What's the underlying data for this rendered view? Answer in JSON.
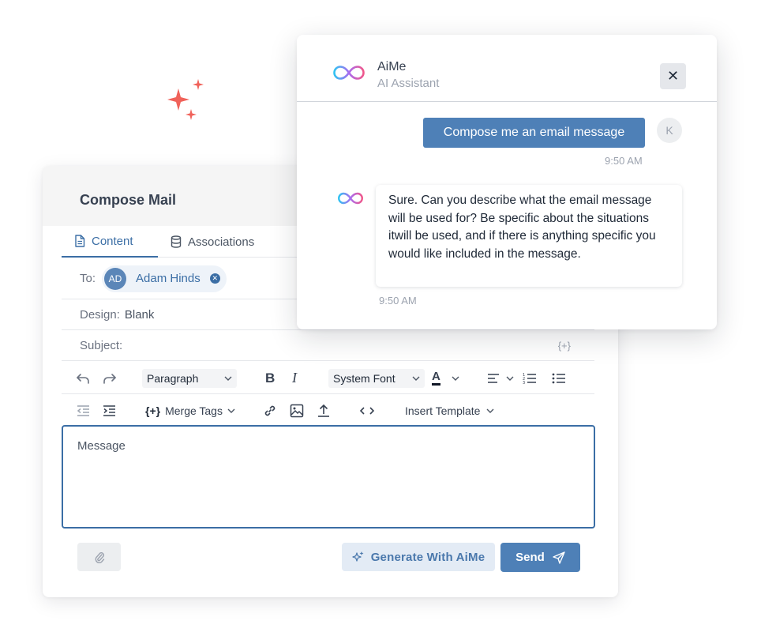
{
  "compose": {
    "title": "Compose Mail",
    "tabs": [
      {
        "label": "Content",
        "icon": "document-icon",
        "active": true
      },
      {
        "label": "Associations",
        "icon": "database-icon",
        "active": false
      }
    ],
    "to_label": "To:",
    "recipient": {
      "initials": "AD",
      "name": "Adam Hinds"
    },
    "design_label": "Design:",
    "design_value": "Blank",
    "subject_label": "Subject:",
    "subject_merge": "{+}",
    "toolbar": {
      "paragraph": "Paragraph",
      "bold": "B",
      "italic": "I",
      "font": "System Font",
      "text_color": "A",
      "merge_tags": "Merge Tags",
      "merge_icon": "{+}",
      "insert_template": "Insert Template"
    },
    "message_placeholder": "Message",
    "generate_label": "Generate With AiMe",
    "send_label": "Send"
  },
  "ai": {
    "name": "AiMe",
    "subtitle": "AI Assistant",
    "close": "✕",
    "user_avatar": "K",
    "messages": [
      {
        "from": "user",
        "text": "Compose me an email message",
        "time": "9:50 AM"
      },
      {
        "from": "bot",
        "text": "Sure. Can you describe what the email message will be used for? Be specific about the situations itwill be used, and if there is anything specific you would like included in the message.",
        "time": "9:50 AM"
      }
    ]
  },
  "colors": {
    "accent": "#4e80b7",
    "sparkle": "#f0625a",
    "logo_gradient": [
      "#2fc3f2",
      "#a86cf0",
      "#f0568a"
    ]
  }
}
